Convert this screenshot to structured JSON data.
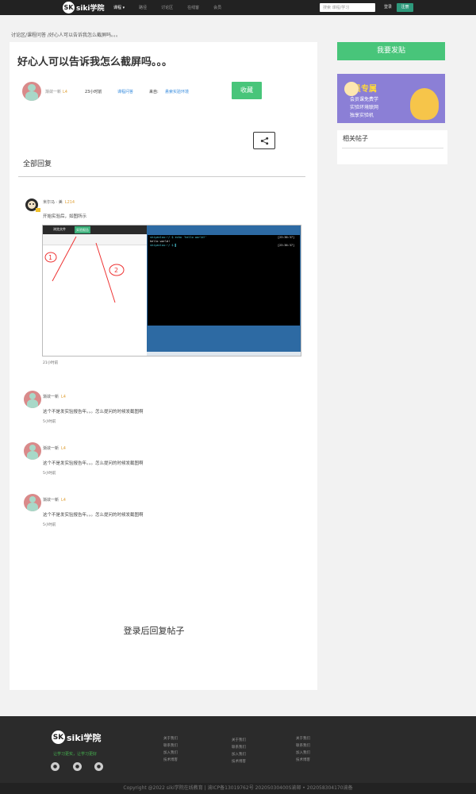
{
  "nav": {
    "logo_mark": "SK",
    "logo_text": "siki学院",
    "items": [
      "课程 ▾",
      "路径",
      "讨论区",
      "在线客",
      "会员"
    ],
    "search_placeholder": "搜索 课程/学习",
    "login": "登录",
    "register": "注册"
  },
  "breadcrumb": "讨论区/课程问答 /好心人可以告诉我怎么截屏吗。。。",
  "post": {
    "title": "好心人可以告诉我怎么截屏吗。。。",
    "author": "渐敛一新",
    "author_level": "L4",
    "time": "23小时前",
    "category": "课程问答",
    "from_label": "来自:",
    "from": "悬索实验环境",
    "collect": "收藏",
    "share_icon": "share-icon"
  },
  "replies_heading": "全部回复",
  "replies": [
    {
      "name": "米尔马 · 美",
      "level": "L214",
      "text": "开始实验后，如图所示",
      "time": "21小时前",
      "shot": {
        "tab1": "浏览文件",
        "tab2": "实验报告",
        "marks": [
          "1",
          "2"
        ],
        "terminal": [
          "shiyanlou:~/ $ echo 'hello world!'",
          "hello world!",
          "shiyanlou:~/ $ ▌"
        ],
        "times": [
          "[23:36:37]",
          "[23:36:37]"
        ]
      }
    },
    {
      "name": "渐敛一新",
      "level": "L4",
      "text": "这个不是发实验报告年。。。怎么提问的时候发截图啊",
      "time": "5小时前"
    },
    {
      "name": "渐敛一新",
      "level": "L4",
      "text": "这个不是发实验报告年。。。怎么提问的时候发截图啊",
      "time": "5小时前"
    },
    {
      "name": "渐敛一新",
      "level": "L4",
      "text": "这个不是发实验报告年。。。怎么提问的时候发截图啊",
      "time": "5小时前"
    }
  ],
  "login_reply": "登录后回复帖子",
  "sidebar": {
    "post_button": "我要发贴",
    "banner_title": "会员专属",
    "banner_lines": [
      "会员课免费学",
      "实验环境联网",
      "独享实验机"
    ],
    "related_title": "相关帖子"
  },
  "footer": {
    "logo_mark": "SK",
    "logo_text": "siki学院",
    "slogan": "让学习更实，让学习更好",
    "social_icons": [
      "wechat-icon",
      "qq-icon",
      "weibo-icon"
    ],
    "col1": [
      "关于我们",
      "联系我们",
      "加入我们",
      "技术博客"
    ],
    "col2": [
      "关于我们",
      "联系我们",
      "加入我们",
      "技术博客"
    ],
    "col3": [
      "关于我们",
      "联系我们",
      "加入我们",
      "技术博客"
    ],
    "copyright": "Copyright @2022 siki学院在线教育 | 渝ICP备13019762号 20205030400S渝邮 • 202058304170渝备"
  },
  "colors": {
    "accent": "#48c57a",
    "nav_bg": "#222222",
    "level": "#e0a23a",
    "footer_bg": "#2b2b2b"
  }
}
